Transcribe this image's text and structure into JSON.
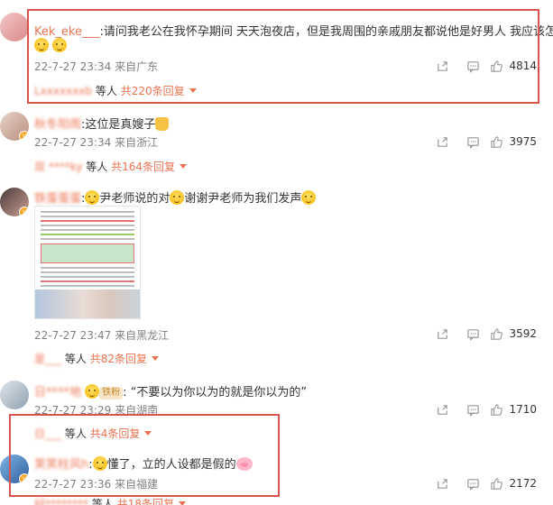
{
  "comments": [
    {
      "username": "Kek_eke___",
      "text": "请问我老公在我怀孕期间 天天泡夜店，但是我周围的亲戚朋友都说他是好男人 我应该怎么办",
      "time": "22-7-27 23:34",
      "location": "来自广东",
      "likes": "4814",
      "reply_user": "Lxxxxxxxb",
      "reply_suffix": "等人",
      "reply_count": "共220条回复"
    },
    {
      "username": "秋冬阳雨",
      "text": "这位是真嫂子",
      "time": "22-7-27 23:34",
      "location": "来自浙江",
      "likes": "3975",
      "reply_user": "双 ****ky",
      "reply_suffix": "等人",
      "reply_count": "共164条回复"
    },
    {
      "username": "铁蛋蛋蛋",
      "text1": "尹老师说的对",
      "text2": "谢谢尹老师为我们发声",
      "time": "22-7-27 23:47",
      "location": "来自黑龙江",
      "likes": "3592",
      "reply_user": "是___",
      "reply_suffix": "等人",
      "reply_count": "共82条回复"
    },
    {
      "username": "日****地",
      "tag": "铁粉",
      "text": "“不要以为你以为的就是你以为的”",
      "time": "22-7-27 23:29",
      "location": "来自湖南",
      "likes": "1710",
      "reply_user": "日___",
      "reply_suffix": "等人",
      "reply_count": "共4条回复"
    },
    {
      "username": "笑笑柱风h",
      "text": "懂了，立的人设都是假的",
      "time": "22-7-27 23:36",
      "location": "来自福建",
      "likes": "2172",
      "reply_user": "好********",
      "reply_suffix": "等人",
      "reply_count": "共18条回复"
    }
  ],
  "icons": {
    "share": "share-icon",
    "comment": "comment-icon",
    "like": "like-icon"
  },
  "colors": {
    "username": "#eb7350",
    "highlight_box": "#d9534f",
    "meta": "#808080"
  }
}
